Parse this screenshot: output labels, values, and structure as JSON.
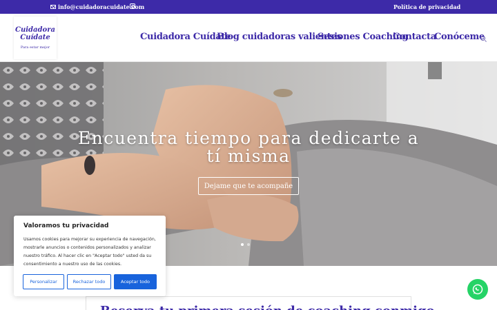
{
  "topbar": {
    "email": "info@cuidadoracuidate.com",
    "privacy_link": "Política de privacidad"
  },
  "header": {
    "logo": {
      "line1": "Cuidadora",
      "line2": "Cuídate",
      "tagline": "Para estar mejor"
    },
    "nav": [
      {
        "label": "Cuidadora Cuídate"
      },
      {
        "label": "Blog cuidadoras valientes"
      },
      {
        "label": "Sesiones Coaching"
      },
      {
        "label": "Contacta"
      },
      {
        "label": "Conóceme"
      }
    ]
  },
  "hero": {
    "title_line1": "Encuentra tiempo para dedicarte a",
    "title_line2": "tí misma",
    "button": "Dejame que te acompañe",
    "active_slide": 1,
    "slide_count": 2
  },
  "booking": {
    "title": "Reserva tu primera sesión de coaching conmigo"
  },
  "cookie_banner": {
    "title": "Valoramos tu privacidad",
    "body": "Usamos cookies para mejorar su experiencia de navegación, mostrarle anuncios o contenidos personalizados y analizar nuestro tráfico. Al hacer clic en \"Aceptar todo\" usted da su consentimiento a nuestro uso de las cookies.",
    "buttons": {
      "customize": "Personalizar",
      "reject": "Rechazar todo",
      "accept": "Aceptar todo"
    }
  },
  "colors": {
    "brand": "#3d2aa8",
    "cookie_accent": "#1863dc",
    "whatsapp": "#25d366"
  }
}
